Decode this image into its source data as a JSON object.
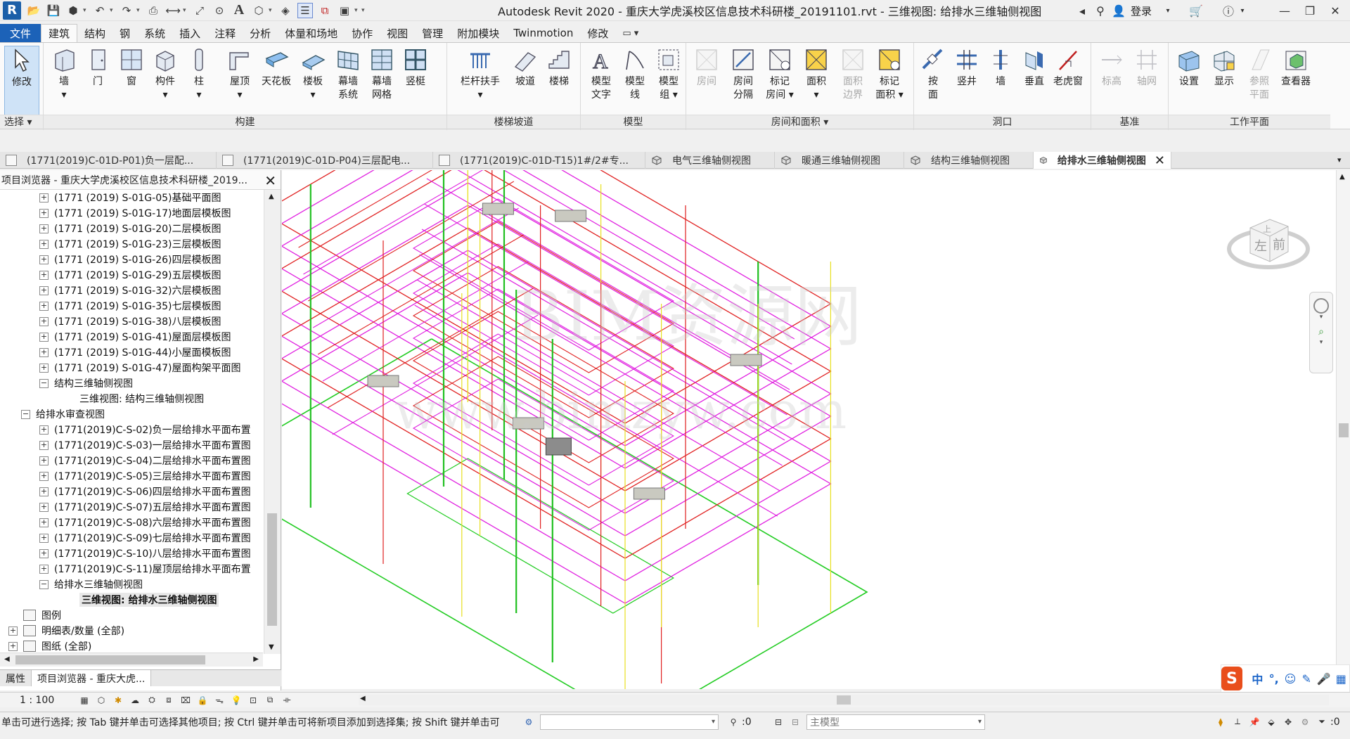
{
  "titlebar": {
    "app_logo": "R",
    "title": "Autodesk Revit 2020 - 重庆大学虎溪校区信息技术科研楼_20191101.rvt - 三维视图: 给排水三维轴侧视图",
    "login_label": "登录",
    "qat_icons": [
      "open-icon",
      "save-icon",
      "sync-icon",
      "undo-icon",
      "redo-icon",
      "print-icon",
      "measure-icon",
      "dimension-icon",
      "tag-icon",
      "text-icon",
      "3d-view-icon",
      "section-icon",
      "thin-lines-icon",
      "close-hidden-icon",
      "switch-windows-icon"
    ]
  },
  "menu": {
    "tabs": [
      "文件",
      "建筑",
      "结构",
      "钢",
      "系统",
      "插入",
      "注释",
      "分析",
      "体量和场地",
      "协作",
      "视图",
      "管理",
      "附加模块",
      "Twinmotion",
      "修改"
    ],
    "active_tab": "建筑"
  },
  "ribbon": {
    "groups": [
      {
        "label": "选择 ▾",
        "buttons": [
          {
            "label": "修改"
          }
        ]
      },
      {
        "label": "构建",
        "buttons": [
          {
            "label": "墙\n▾"
          },
          {
            "label": "门"
          },
          {
            "label": "窗"
          },
          {
            "label": "构件\n▾"
          },
          {
            "label": "柱\n▾"
          },
          {
            "label": "屋顶\n▾"
          },
          {
            "label": "天花板"
          },
          {
            "label": "楼板\n▾"
          },
          {
            "label": "幕墙\n系统"
          },
          {
            "label": "幕墙\n网格"
          },
          {
            "label": "竖梃"
          }
        ]
      },
      {
        "label": "楼梯坡道",
        "buttons": [
          {
            "label": "栏杆扶手\n▾"
          },
          {
            "label": "坡道"
          },
          {
            "label": "楼梯"
          }
        ]
      },
      {
        "label": "模型",
        "buttons": [
          {
            "label": "模型\n文字"
          },
          {
            "label": "模型\n线"
          },
          {
            "label": "模型\n组 ▾"
          }
        ]
      },
      {
        "label": "房间和面积 ▾",
        "buttons": [
          {
            "label": "房间",
            "disabled": true
          },
          {
            "label": "房间\n分隔"
          },
          {
            "label": "标记\n房间 ▾"
          },
          {
            "label": "面积\n▾"
          },
          {
            "label": "面积\n边界",
            "disabled": true
          },
          {
            "label": "标记\n面积 ▾"
          }
        ]
      },
      {
        "label": "洞口",
        "buttons": [
          {
            "label": "按\n面"
          },
          {
            "label": "竖井"
          },
          {
            "label": "墙"
          },
          {
            "label": "垂直"
          },
          {
            "label": "老虎窗"
          }
        ]
      },
      {
        "label": "基准",
        "buttons": [
          {
            "label": "标高",
            "disabled": true
          },
          {
            "label": "轴网",
            "disabled": true
          }
        ]
      },
      {
        "label": "工作平面",
        "buttons": [
          {
            "label": "设置"
          },
          {
            "label": "显示"
          },
          {
            "label": "参照\n平面",
            "disabled": true
          },
          {
            "label": "查看器"
          }
        ]
      }
    ]
  },
  "doc_tabs": [
    {
      "label": "(1771(2019)C-01D-P01)负一层配...",
      "type": "sheet"
    },
    {
      "label": "(1771(2019)C-01D-P04)三层配电...",
      "type": "sheet"
    },
    {
      "label": "(1771(2019)C-01D-T15)1#/2#专...",
      "type": "sheet"
    },
    {
      "label": "电气三维轴侧视图",
      "type": "3d"
    },
    {
      "label": "暖通三维轴侧视图",
      "type": "3d"
    },
    {
      "label": "结构三维轴侧视图",
      "type": "3d"
    },
    {
      "label": "给排水三维轴侧视图",
      "type": "3d",
      "active": true
    }
  ],
  "browser": {
    "title": "项目浏览器 - 重庆大学虎溪校区信息技术科研楼_2019...",
    "items": [
      {
        "label": "(1771 (2019) S-01G-05)基础平面图",
        "level": 2,
        "exp": "+"
      },
      {
        "label": "(1771 (2019) S-01G-17)地面层模板图",
        "level": 2,
        "exp": "+"
      },
      {
        "label": "(1771 (2019) S-01G-20)二层模板图",
        "level": 2,
        "exp": "+"
      },
      {
        "label": "(1771 (2019) S-01G-23)三层模板图",
        "level": 2,
        "exp": "+"
      },
      {
        "label": "(1771 (2019) S-01G-26)四层模板图",
        "level": 2,
        "exp": "+"
      },
      {
        "label": "(1771 (2019) S-01G-29)五层模板图",
        "level": 2,
        "exp": "+"
      },
      {
        "label": "(1771 (2019) S-01G-32)六层模板图",
        "level": 2,
        "exp": "+"
      },
      {
        "label": "(1771 (2019) S-01G-35)七层模板图",
        "level": 2,
        "exp": "+"
      },
      {
        "label": "(1771 (2019) S-01G-38)八层模板图",
        "level": 2,
        "exp": "+"
      },
      {
        "label": "(1771 (2019) S-01G-41)屋面层模板图",
        "level": 2,
        "exp": "+"
      },
      {
        "label": "(1771 (2019) S-01G-44)小屋面模板图",
        "level": 2,
        "exp": "+"
      },
      {
        "label": "(1771 (2019) S-01G-47)屋面构架平面图",
        "level": 2,
        "exp": "+"
      },
      {
        "label": "结构三维轴侧视图",
        "level": 2,
        "exp": "−"
      },
      {
        "label": "三维视图: 结构三维轴侧视图",
        "level": 3,
        "exp": ""
      },
      {
        "label": "给排水审查视图",
        "level": 1,
        "exp": "−"
      },
      {
        "label": "(1771(2019)C-S-02)负一层给排水平面布置",
        "level": 2,
        "exp": "+"
      },
      {
        "label": "(1771(2019)C-S-03)一层给排水平面布置图",
        "level": 2,
        "exp": "+"
      },
      {
        "label": "(1771(2019)C-S-04)二层给排水平面布置图",
        "level": 2,
        "exp": "+"
      },
      {
        "label": "(1771(2019)C-S-05)三层给排水平面布置图",
        "level": 2,
        "exp": "+"
      },
      {
        "label": "(1771(2019)C-S-06)四层给排水平面布置图",
        "level": 2,
        "exp": "+"
      },
      {
        "label": "(1771(2019)C-S-07)五层给排水平面布置图",
        "level": 2,
        "exp": "+"
      },
      {
        "label": "(1771(2019)C-S-08)六层给排水平面布置图",
        "level": 2,
        "exp": "+"
      },
      {
        "label": "(1771(2019)C-S-09)七层给排水平面布置图",
        "level": 2,
        "exp": "+"
      },
      {
        "label": "(1771(2019)C-S-10)八层给排水平面布置图",
        "level": 2,
        "exp": "+"
      },
      {
        "label": "(1771(2019)C-S-11)屋顶层给排水平面布置",
        "level": 2,
        "exp": "+"
      },
      {
        "label": "给排水三维轴侧视图",
        "level": 2,
        "exp": "−"
      },
      {
        "label": "三维视图: 给排水三维轴侧视图",
        "level": 3,
        "exp": "",
        "selected": true
      },
      {
        "label": "图例",
        "level": 0,
        "exp": "",
        "icon": true
      },
      {
        "label": "明细表/数量 (全部)",
        "level": 0,
        "exp": "+",
        "icon": true
      },
      {
        "label": "图纸 (全部)",
        "level": 0,
        "exp": "+",
        "icon": true
      }
    ],
    "tabs": [
      "属性",
      "项目浏览器 - 重庆大虎..."
    ]
  },
  "viewbar": {
    "scale": "1 : 100"
  },
  "statusbar": {
    "text": "单击可进行选择; 按 Tab 键并单击可选择其他项目; 按 Ctrl 键并单击可将新项目添加到选择集; 按 Shift 键并单击可",
    "count_left": ":0",
    "model_combo": "主模型",
    "count_right": ":0"
  },
  "watermark": {
    "line1": "BIM资源网",
    "line2": "www.bimzyw.com"
  },
  "ime": {
    "logo": "S",
    "mode": "中"
  },
  "viewcube": {
    "top": "上",
    "front": "前",
    "left": "左"
  },
  "colors": {
    "accent": "#1c62b8",
    "pipe_magenta": "#e020e0",
    "pipe_red": "#e02020",
    "pipe_green": "#20c020",
    "pipe_yellow": "#e8e020",
    "grid_green": "#22cc22"
  }
}
